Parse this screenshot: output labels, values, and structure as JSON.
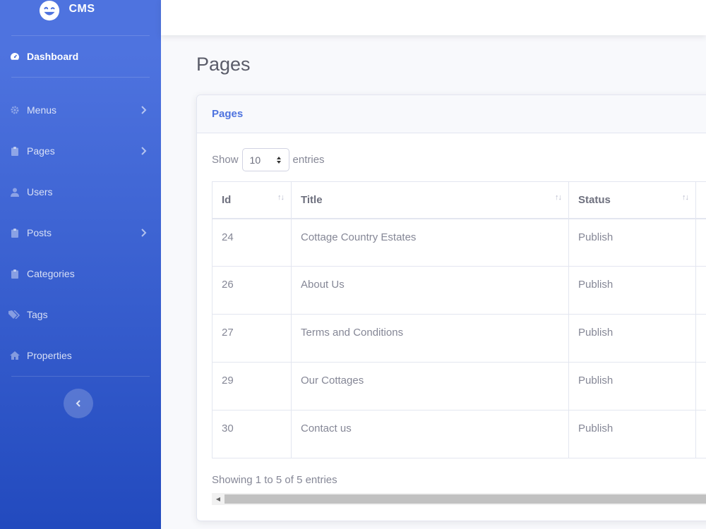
{
  "brand": {
    "name": "CMS"
  },
  "sidebar": {
    "items": [
      {
        "label": "Dashboard",
        "icon": "tachometer-icon",
        "active": true
      },
      {
        "label": "Menus",
        "icon": "cog-icon",
        "has_children": true
      },
      {
        "label": "Pages",
        "icon": "clipboard-icon",
        "has_children": true
      },
      {
        "label": "Users",
        "icon": "user-icon"
      },
      {
        "label": "Posts",
        "icon": "clipboard-icon",
        "has_children": true
      },
      {
        "label": "Categories",
        "icon": "clipboard-icon"
      },
      {
        "label": "Tags",
        "icon": "tags-icon"
      },
      {
        "label": "Properties",
        "icon": "home-icon"
      }
    ]
  },
  "page": {
    "title": "Pages"
  },
  "card": {
    "header": "Pages"
  },
  "table_controls": {
    "show_label": "Show",
    "entries_label": "entries",
    "page_length": "10"
  },
  "table": {
    "columns": [
      "Id",
      "Title",
      "Status"
    ],
    "rows": [
      {
        "id": "24",
        "title": "Cottage Country Estates",
        "status": "Publish"
      },
      {
        "id": "26",
        "title": "About Us",
        "status": "Publish"
      },
      {
        "id": "27",
        "title": "Terms and Conditions",
        "status": "Publish"
      },
      {
        "id": "29",
        "title": "Our Cottages",
        "status": "Publish"
      },
      {
        "id": "30",
        "title": "Contact us",
        "status": "Publish"
      }
    ],
    "info": "Showing 1 to 5 of 5 entries"
  },
  "colors": {
    "primary": "#4e73df",
    "sidebar_bottom": "#224abe"
  }
}
